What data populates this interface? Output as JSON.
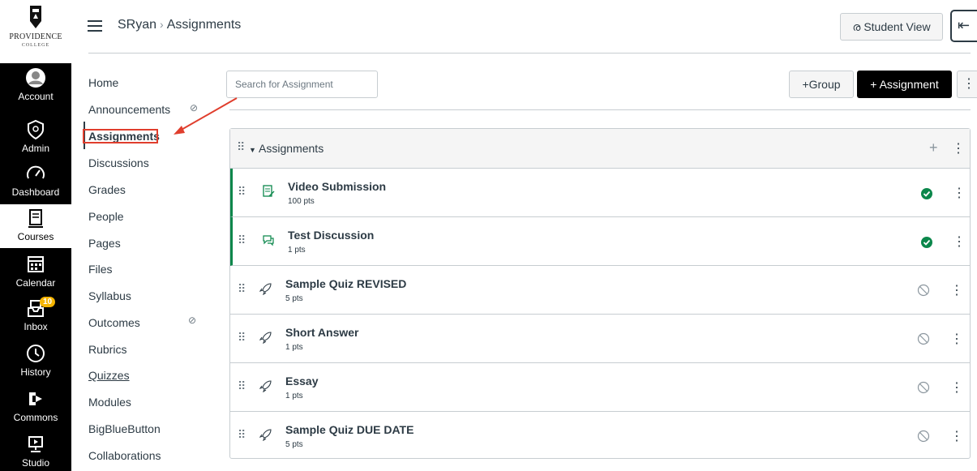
{
  "global_nav": {
    "logo": {
      "name": "PROVIDENCE",
      "sub": "COLLEGE"
    },
    "items": [
      {
        "label": "Account",
        "icon": "account-icon"
      },
      {
        "label": "Admin",
        "icon": "admin-icon"
      },
      {
        "label": "Dashboard",
        "icon": "dashboard-icon"
      },
      {
        "label": "Courses",
        "icon": "courses-icon"
      },
      {
        "label": "Calendar",
        "icon": "calendar-icon"
      },
      {
        "label": "Inbox",
        "icon": "inbox-icon",
        "badge": "10"
      },
      {
        "label": "History",
        "icon": "history-icon"
      },
      {
        "label": "Commons",
        "icon": "commons-icon"
      },
      {
        "label": "Studio",
        "icon": "studio-icon"
      }
    ]
  },
  "header": {
    "breadcrumb": [
      "SRyan",
      "Assignments"
    ],
    "student_view_label": "Student View",
    "student_view_icon": "glasses-icon"
  },
  "course_nav": {
    "items": [
      {
        "label": "Home"
      },
      {
        "label": "Announcements",
        "hidden": true
      },
      {
        "label": "Assignments",
        "active": true
      },
      {
        "label": "Discussions"
      },
      {
        "label": "Grades"
      },
      {
        "label": "People"
      },
      {
        "label": "Pages"
      },
      {
        "label": "Files"
      },
      {
        "label": "Syllabus"
      },
      {
        "label": "Outcomes",
        "hidden": true
      },
      {
        "label": "Rubrics"
      },
      {
        "label": "Quizzes"
      },
      {
        "label": "Modules"
      },
      {
        "label": "BigBlueButton"
      },
      {
        "label": "Collaborations"
      }
    ]
  },
  "toolbar": {
    "search_placeholder": "Search for Assignment",
    "group_label": "+Group",
    "assignment_label": "+ Assignment"
  },
  "assignment_group": {
    "title": "Assignments",
    "items": [
      {
        "title": "Video Submission",
        "points": "100 pts",
        "type": "assignment-icon",
        "published": true
      },
      {
        "title": "Test Discussion",
        "points": "1 pts",
        "type": "discussion-icon",
        "published": true
      },
      {
        "title": "Sample Quiz REVISED",
        "points": "5 pts",
        "type": "quiz-rocket-icon",
        "published": false
      },
      {
        "title": "Short Answer",
        "points": "1 pts",
        "type": "quiz-rocket-icon",
        "published": false
      },
      {
        "title": "Essay",
        "points": "1 pts",
        "type": "quiz-rocket-icon",
        "published": false
      },
      {
        "title": "Sample Quiz DUE DATE",
        "points": "5 pts",
        "type": "quiz-rocket-icon",
        "published": false
      }
    ]
  },
  "colors": {
    "published": "#0b874b",
    "highlight": "#e03e2d",
    "badge": "#f5b400"
  }
}
